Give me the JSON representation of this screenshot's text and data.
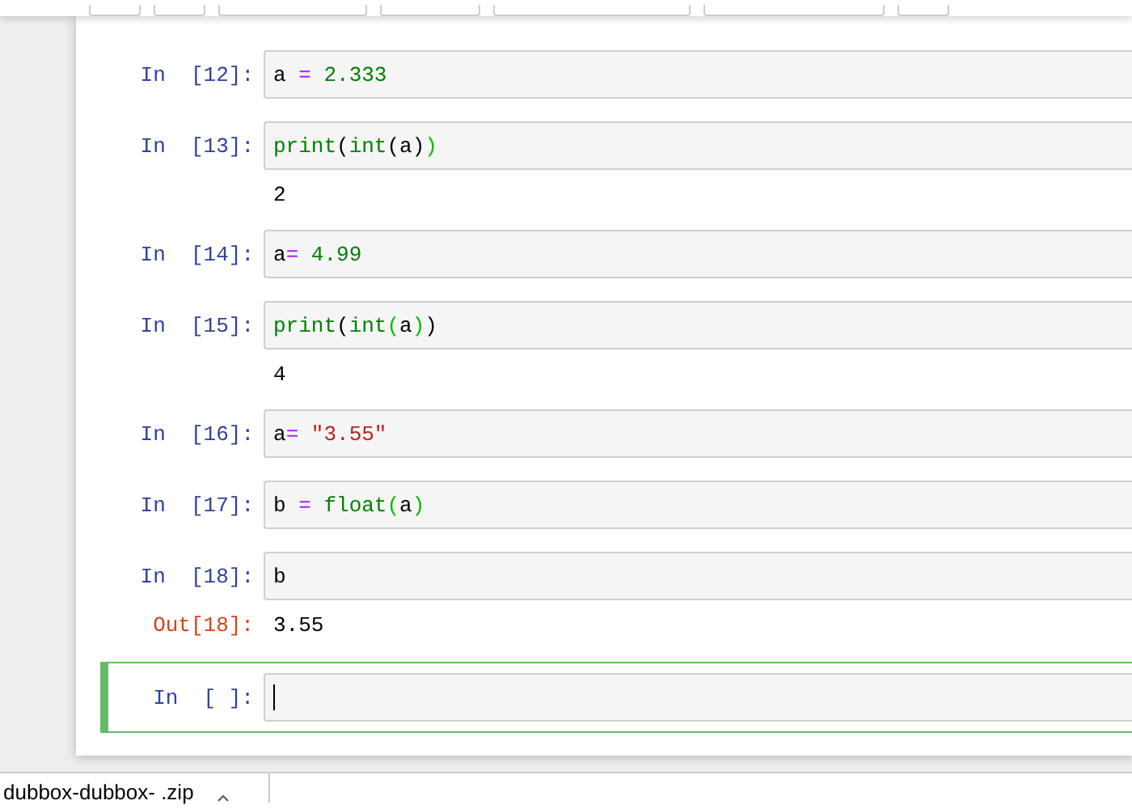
{
  "cells": [
    {
      "prompt": "In  [12]:",
      "selected": false,
      "tokens": [
        {
          "kind": "name",
          "s": "a"
        },
        {
          "kind": "op",
          "s": " = "
        },
        {
          "kind": "num",
          "s": "2.333"
        }
      ]
    },
    {
      "prompt": "In  [13]:",
      "selected": false,
      "tokens": [
        {
          "kind": "builtin",
          "s": "print"
        },
        {
          "kind": "paren",
          "s": "("
        },
        {
          "kind": "builtin",
          "s": "int"
        },
        {
          "kind": "paren",
          "s": "(a)"
        },
        {
          "kind": "match",
          "s": ")"
        }
      ],
      "output": {
        "kind": "stream",
        "text": "2"
      }
    },
    {
      "prompt": "In  [14]:",
      "selected": false,
      "tokens": [
        {
          "kind": "name",
          "s": "a"
        },
        {
          "kind": "op",
          "s": "= "
        },
        {
          "kind": "num",
          "s": "4.99"
        }
      ]
    },
    {
      "prompt": "In  [15]:",
      "selected": false,
      "tokens": [
        {
          "kind": "builtin",
          "s": "print"
        },
        {
          "kind": "paren",
          "s": "("
        },
        {
          "kind": "builtin",
          "s": "int"
        },
        {
          "kind": "match",
          "s": "("
        },
        {
          "kind": "name",
          "s": "a"
        },
        {
          "kind": "match",
          "s": ")"
        },
        {
          "kind": "paren",
          "s": ")"
        }
      ],
      "output": {
        "kind": "stream",
        "text": "4"
      }
    },
    {
      "prompt": "In  [16]:",
      "selected": false,
      "tokens": [
        {
          "kind": "name",
          "s": "a"
        },
        {
          "kind": "op",
          "s": "= "
        },
        {
          "kind": "string",
          "s": "″3.55″"
        }
      ]
    },
    {
      "prompt": "In  [17]:",
      "selected": false,
      "tokens": [
        {
          "kind": "name",
          "s": "b"
        },
        {
          "kind": "op",
          "s": " = "
        },
        {
          "kind": "builtin",
          "s": "float"
        },
        {
          "kind": "match",
          "s": "("
        },
        {
          "kind": "name",
          "s": "a"
        },
        {
          "kind": "match",
          "s": ")"
        }
      ]
    },
    {
      "prompt": "In  [18]:",
      "selected": false,
      "tokens": [
        {
          "kind": "name",
          "s": "b"
        }
      ],
      "output": {
        "kind": "result",
        "prompt": "Out[18]:",
        "text": "3.55"
      }
    },
    {
      "prompt": "In  [ ]:",
      "selected": true
    }
  ],
  "download_bar": {
    "file": "dubbox-dubbox-  .zip"
  }
}
